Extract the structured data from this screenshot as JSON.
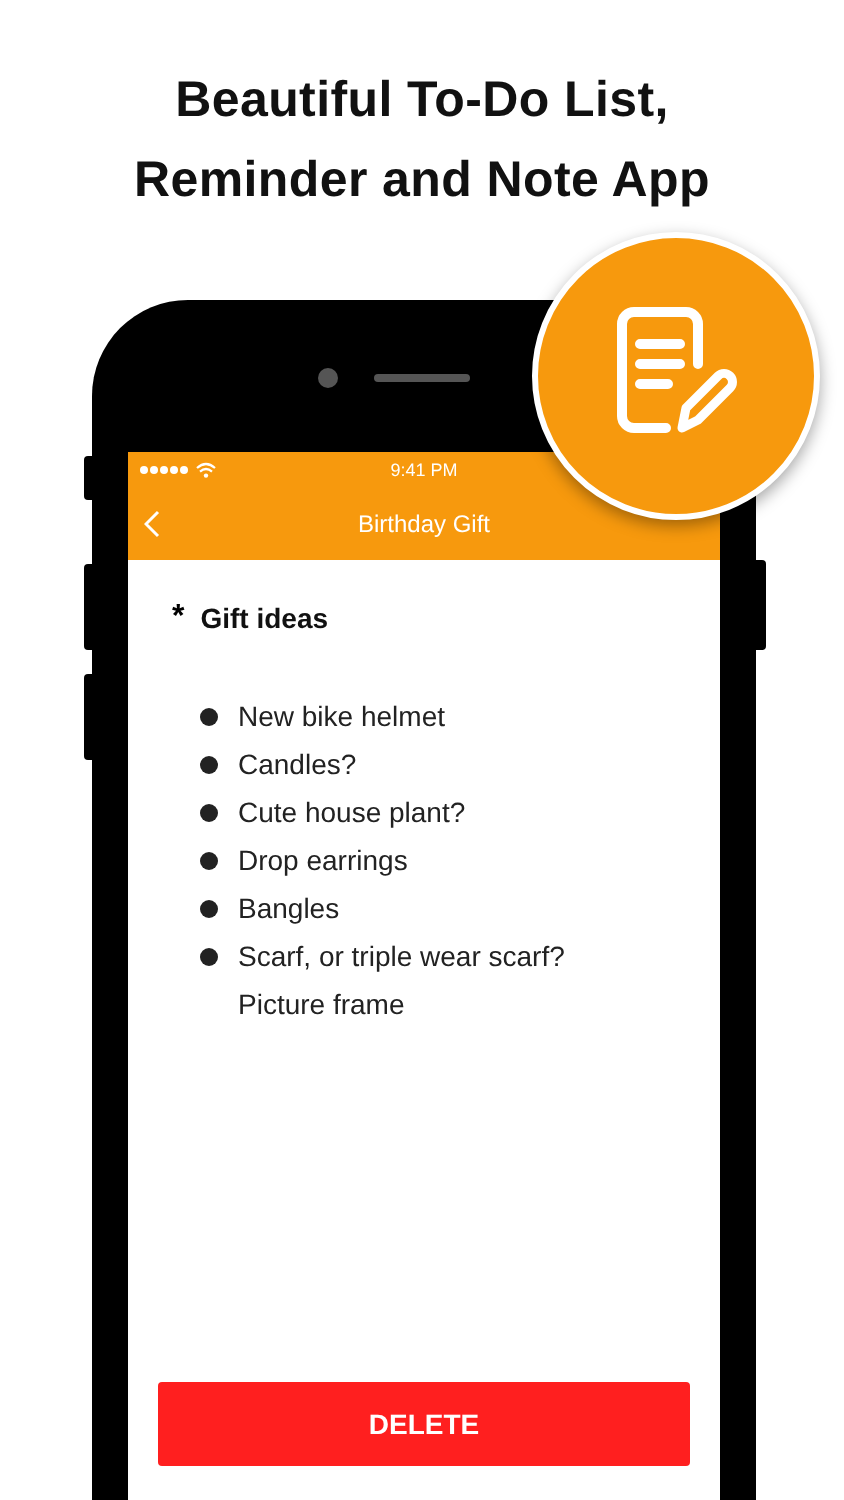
{
  "headline": [
    "Beautiful To-Do List,",
    "Reminder and Note App"
  ],
  "status_bar": {
    "time": "9:41 PM"
  },
  "nav_bar": {
    "title": "Birthday Gift"
  },
  "note": {
    "heading_marker": "*",
    "heading": "Gift ideas",
    "lines": [
      {
        "kind": "bullet",
        "text": "New bike helmet"
      },
      {
        "kind": "bullet",
        "text": "Candles?"
      },
      {
        "kind": "bullet",
        "text": "Cute house plant?"
      },
      {
        "kind": "bullet",
        "text": "Drop earrings"
      },
      {
        "kind": "bullet",
        "text": "Bangles"
      },
      {
        "kind": "bullet",
        "text": "Scarf, or triple wear scarf?"
      },
      {
        "kind": "plain",
        "text": "Picture frame"
      }
    ]
  },
  "delete_button": "DELETE"
}
